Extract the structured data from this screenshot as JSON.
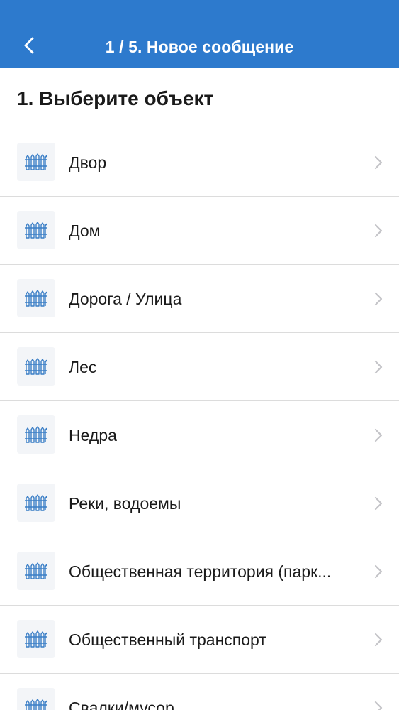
{
  "header": {
    "title": "1 / 5. Новое сообщение",
    "back_icon": "chevron-left-icon",
    "background_color": "#2d7acd"
  },
  "page": {
    "title": "1. Выберите объект"
  },
  "list": {
    "item_icon": "fence-icon",
    "chevron_icon": "chevron-right-icon",
    "items": [
      {
        "label": "Двор"
      },
      {
        "label": "Дом"
      },
      {
        "label": "Дорога / Улица"
      },
      {
        "label": "Лес"
      },
      {
        "label": "Недра"
      },
      {
        "label": "Реки, водоемы"
      },
      {
        "label": "Общественная территория (парк..."
      },
      {
        "label": "Общественный транспорт"
      },
      {
        "label": "Свалки/мусор"
      }
    ]
  }
}
